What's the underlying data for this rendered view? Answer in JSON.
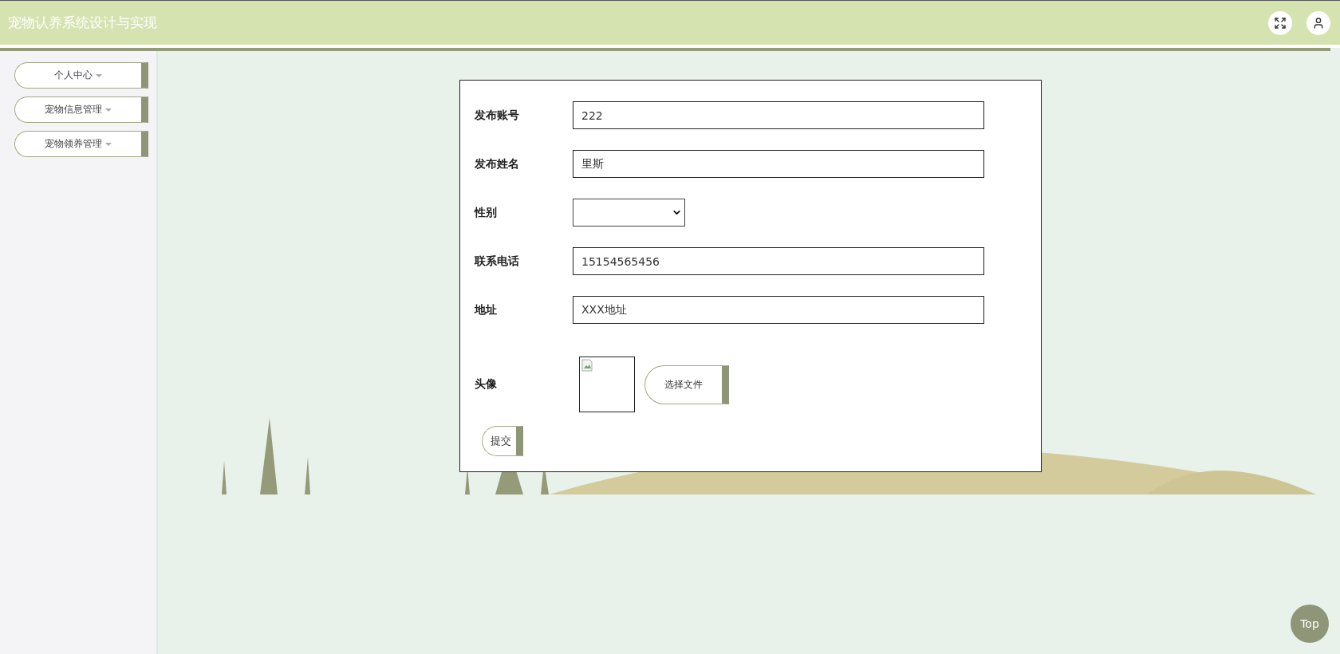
{
  "header": {
    "title": "宠物认养系统设计与实现"
  },
  "sidebar": {
    "items": [
      {
        "label": "个人中心"
      },
      {
        "label": "宠物信息管理"
      },
      {
        "label": "宠物领养管理"
      }
    ]
  },
  "form": {
    "fields": [
      {
        "kind": "text",
        "label": "发布账号",
        "value": "222"
      },
      {
        "kind": "text",
        "label": "发布姓名",
        "value": "里斯"
      },
      {
        "kind": "select",
        "label": "性别"
      },
      {
        "kind": "text",
        "label": "联系电话",
        "value": "15154565456"
      },
      {
        "kind": "text",
        "label": "地址",
        "value": "XXX地址"
      },
      {
        "kind": "image",
        "label": "头像",
        "button": "选择文件"
      }
    ],
    "submit": "提交"
  },
  "back_to_top": "Top"
}
